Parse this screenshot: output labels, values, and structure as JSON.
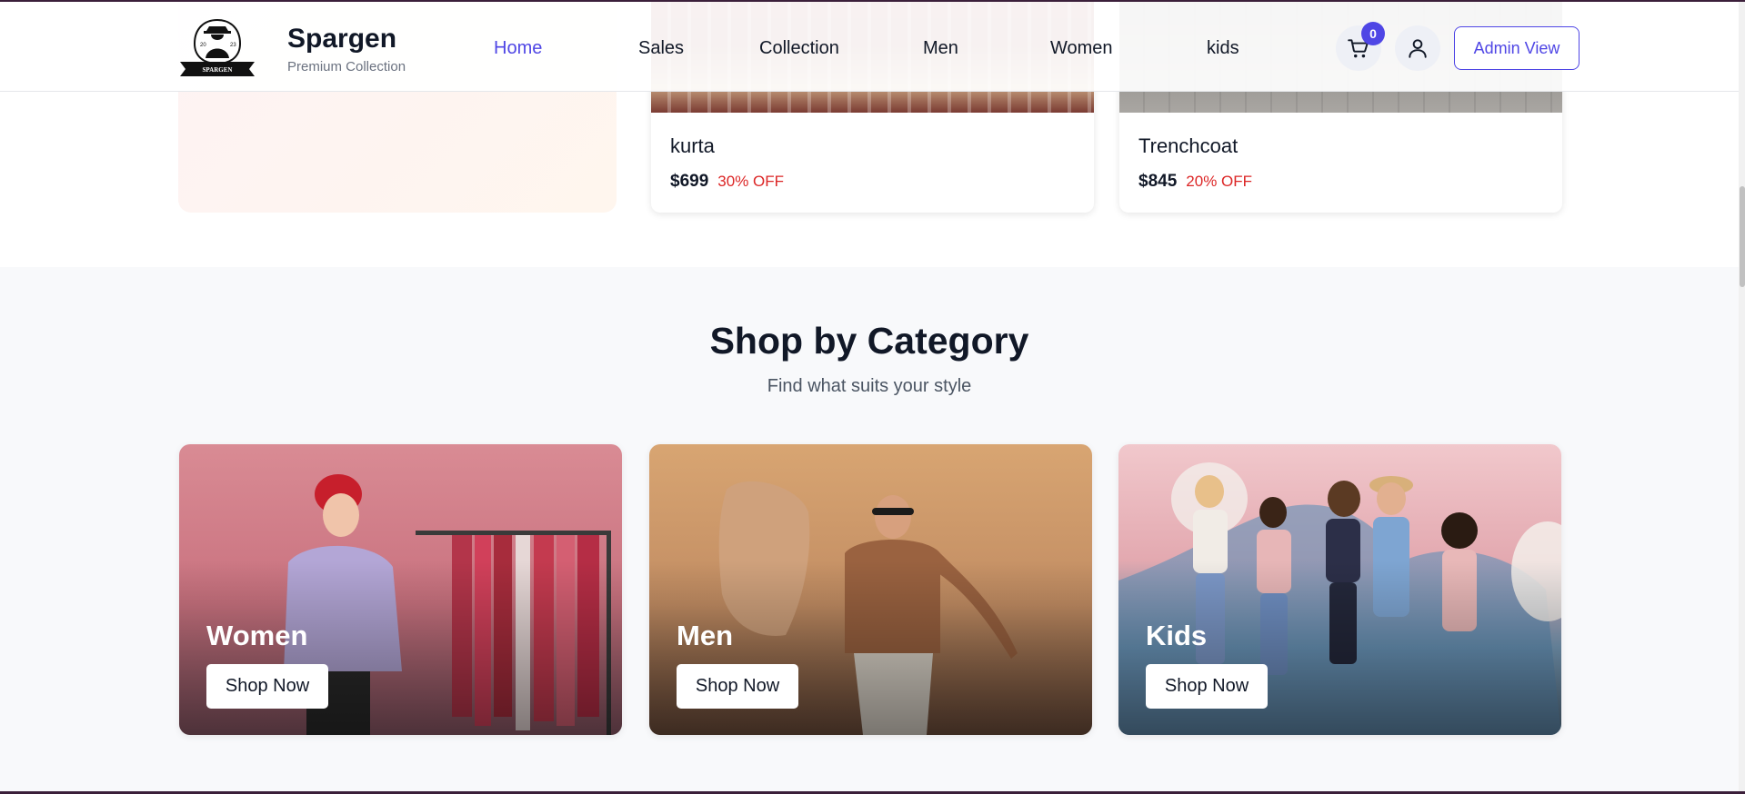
{
  "header": {
    "brand_name": "Spargen",
    "brand_tagline": "Premium Collection",
    "logo_text": "SPARGEN",
    "nav": [
      {
        "label": "Home",
        "active": true
      },
      {
        "label": "Sales"
      },
      {
        "label": "Collection"
      },
      {
        "label": "Men"
      },
      {
        "label": "Women"
      },
      {
        "label": "kids"
      }
    ],
    "cart_count": "0",
    "admin_button": "Admin View",
    "icons": {
      "cart": "cart-icon",
      "user": "user-icon"
    }
  },
  "products": [
    {
      "name": "kurta",
      "price": "$699",
      "discount": "30% OFF"
    },
    {
      "name": "Trenchcoat",
      "price": "$845",
      "discount": "20% OFF"
    }
  ],
  "category_section": {
    "title": "Shop by Category",
    "subtitle": "Find what suits your style",
    "categories": [
      {
        "name": "Women",
        "button": "Shop Now"
      },
      {
        "name": "Men",
        "button": "Shop Now"
      },
      {
        "name": "Kids",
        "button": "Shop Now"
      }
    ]
  },
  "colors": {
    "accent": "#4f46e5",
    "discount": "#dc2626",
    "section_bg": "#f8f9fb"
  }
}
